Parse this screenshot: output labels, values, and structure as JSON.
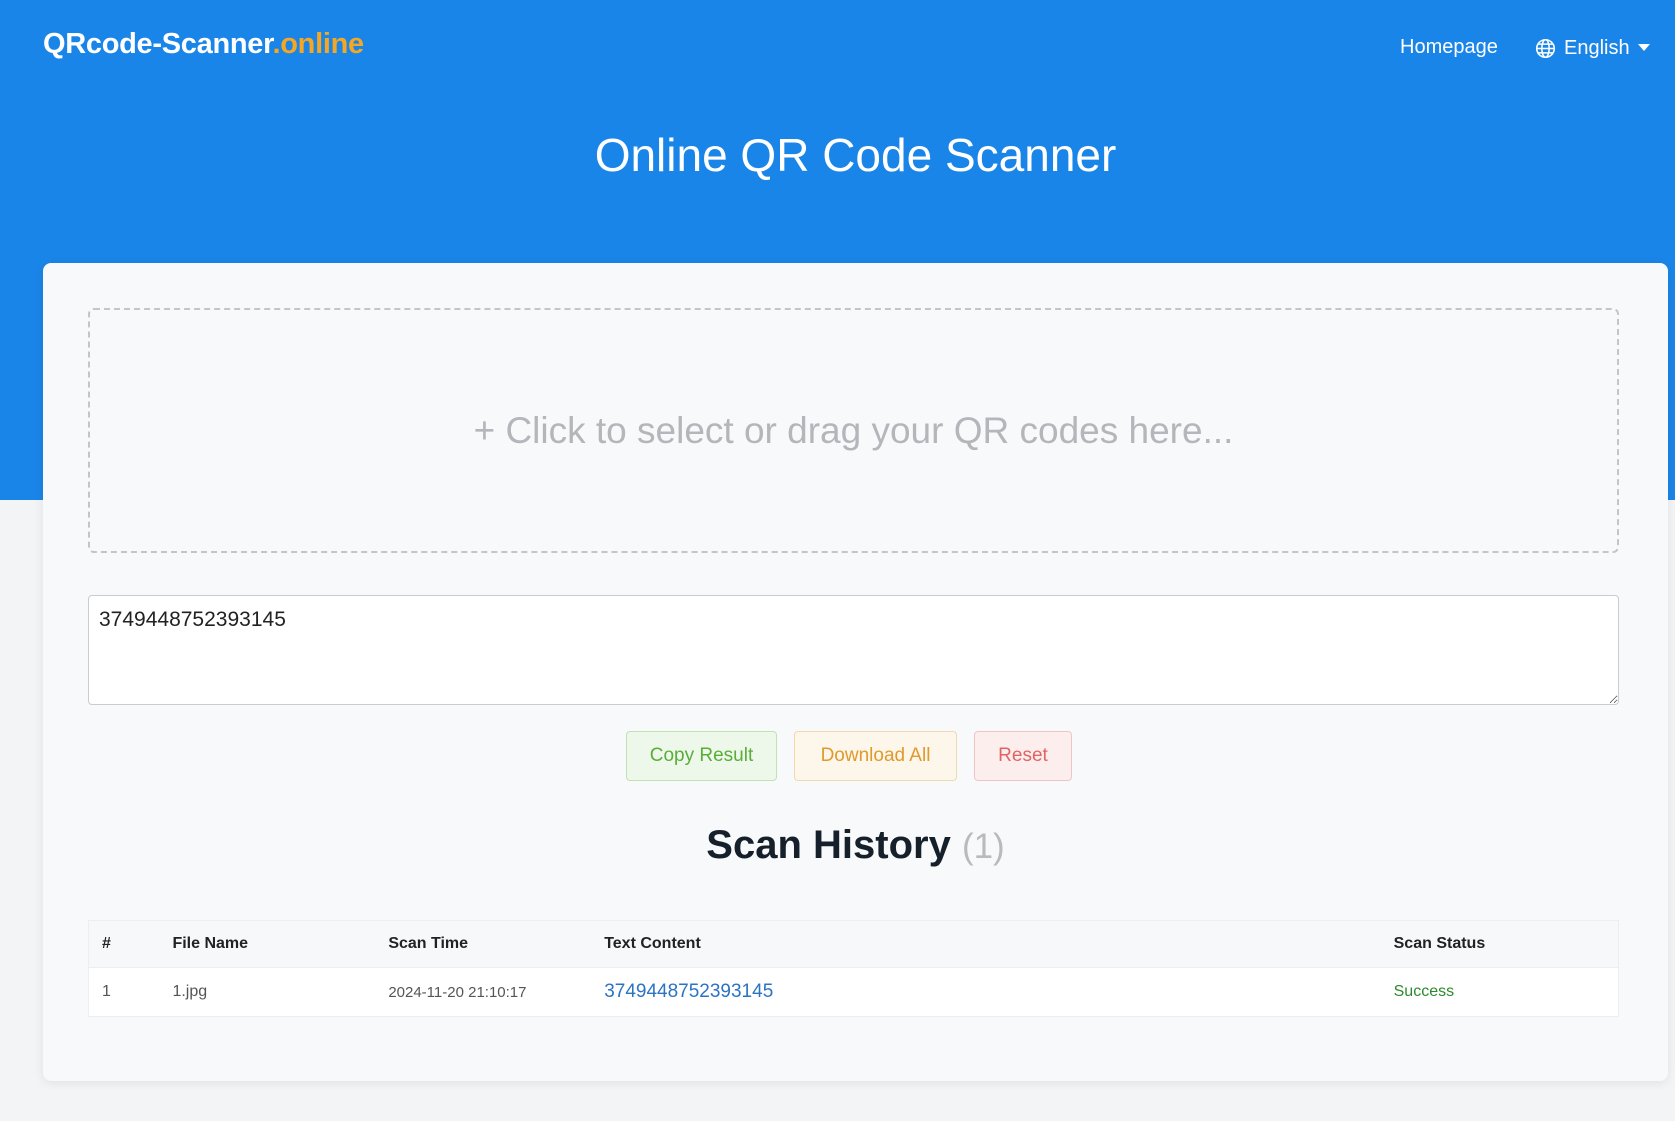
{
  "header": {
    "logo_main": "QRcode-Scanner",
    "logo_tld": ".online",
    "nav_home": "Homepage",
    "language": "English"
  },
  "page": {
    "title": "Online QR Code Scanner"
  },
  "dropzone": {
    "placeholder": "+ Click to select or drag your QR codes here..."
  },
  "result": {
    "value": "3749448752393145"
  },
  "buttons": {
    "copy": "Copy Result",
    "download": "Download All",
    "reset": "Reset"
  },
  "history": {
    "title": "Scan History",
    "count": "(1)",
    "columns": {
      "index": "#",
      "file_name": "File Name",
      "scan_time": "Scan Time",
      "text_content": "Text Content",
      "scan_status": "Scan Status"
    },
    "rows": [
      {
        "index": "1",
        "file_name": "1.jpg",
        "scan_time": "2024-11-20 21:10:17",
        "text_content": "3749448752393145",
        "scan_status": "Success"
      }
    ]
  },
  "colors": {
    "brand_blue": "#1a85e8",
    "tld_orange": "#f5a623",
    "copy_green": "#5aad3a",
    "download_orange": "#e09a2b",
    "reset_red": "#e06464",
    "link_blue": "#2a74c2",
    "success_green": "#2c8a2c"
  },
  "icons": {
    "language": "globe-icon",
    "language_dropdown": "caret-down-icon"
  }
}
